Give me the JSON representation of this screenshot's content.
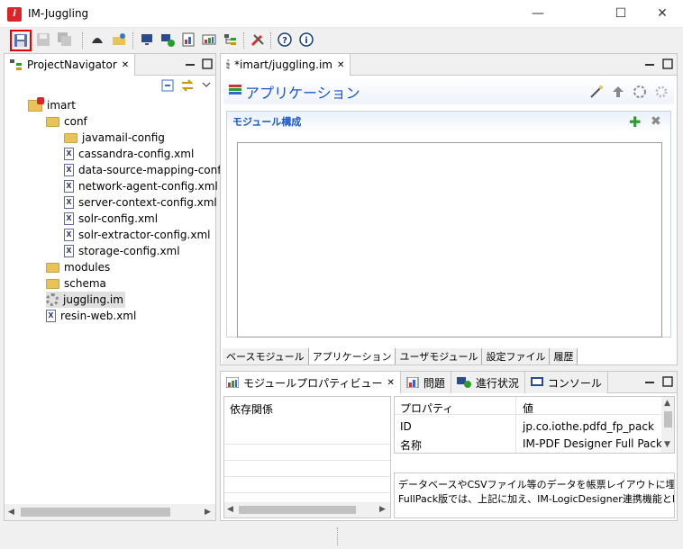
{
  "window": {
    "title": "IM-Juggling",
    "app_icon_letter": "i",
    "minimize": "—",
    "maximize": "☐",
    "close": "✕"
  },
  "toolbar": {
    "icons": [
      "save-icon",
      "save-as-icon",
      "save-all-icon",
      "helmet-icon",
      "open-folder-icon",
      "monitor-icon",
      "add-monitor-icon",
      "report-icon",
      "chart-icon",
      "tree-icon",
      "tools-icon",
      "help-icon",
      "info-icon"
    ],
    "help_glyph": "?",
    "info_glyph": "i"
  },
  "navigator": {
    "tab_label": "ProjectNavigator",
    "tab_close": "✕",
    "tree": [
      {
        "label": "imart",
        "type": "project",
        "indent": 0
      },
      {
        "label": "conf",
        "type": "folder",
        "indent": 1
      },
      {
        "label": "javamail-config",
        "type": "folder",
        "indent": 2
      },
      {
        "label": "cassandra-config.xml",
        "type": "xml",
        "indent": 2
      },
      {
        "label": "data-source-mapping-config",
        "type": "xml",
        "indent": 2
      },
      {
        "label": "network-agent-config.xml",
        "type": "xml",
        "indent": 2
      },
      {
        "label": "server-context-config.xml",
        "type": "xml",
        "indent": 2
      },
      {
        "label": "solr-config.xml",
        "type": "xml",
        "indent": 2
      },
      {
        "label": "solr-extractor-config.xml",
        "type": "xml",
        "indent": 2
      },
      {
        "label": "storage-config.xml",
        "type": "xml",
        "indent": 2
      },
      {
        "label": "modules",
        "type": "folder",
        "indent": 1
      },
      {
        "label": "schema",
        "type": "folder",
        "indent": 1
      },
      {
        "label": "juggling.im",
        "type": "gear",
        "indent": 1,
        "selected": true
      },
      {
        "label": "resin-web.xml",
        "type": "xml",
        "indent": 1
      }
    ],
    "xml_glyph": "X"
  },
  "editor": {
    "tab_label": "*imart/juggling.im",
    "tab_close": "✕",
    "heading": "アプリケーション",
    "section_title": "モジュール構成",
    "add_glyph": "✚",
    "remove_glyph": "✖",
    "subtabs": [
      "ベースモジュール",
      "アプリケーション",
      "ユーザモジュール",
      "設定ファイル",
      "履歴"
    ],
    "active_subtab": 1
  },
  "bottom": {
    "tabs": [
      {
        "label": "モジュールプロパティビュー",
        "close": "✕",
        "active": true
      },
      {
        "label": "問題"
      },
      {
        "label": "進行状況"
      },
      {
        "label": "コンソール"
      }
    ],
    "left_header": "依存関係",
    "prop_headers": [
      "プロパティ",
      "値"
    ],
    "props": [
      {
        "key": "ID",
        "value": "jp.co.iothe.pdfd_fp_pack"
      },
      {
        "key": "名称",
        "value": "IM-PDF Designer Full Pack fo"
      }
    ],
    "description_line1": "データベースやCSVファイル等のデータを帳票レイアウトに埋め込み、",
    "description_line2": "FullPack版では、上記に加え、IM-LogicDesigner連携機能とR"
  },
  "colors": {
    "selection_border": "#e00000",
    "heading_blue": "#1a57c2",
    "add_green": "#2a9d2a"
  }
}
